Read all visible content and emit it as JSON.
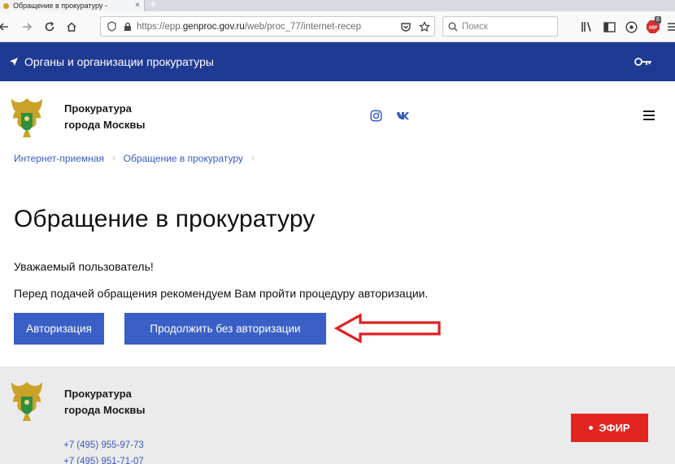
{
  "browser": {
    "tab_title": "Обращение в прокуратуру - ",
    "tab_close": "×",
    "tab_new": "+",
    "url_prefix": "https://epp.",
    "url_domain": "genproc.gov.ru",
    "url_path": "/web/proc_77/internet-recep",
    "search_placeholder": "Поиск",
    "abp_badge": "8"
  },
  "site_strip": {
    "label": "Органы и организации прокуратуры"
  },
  "header": {
    "org_line1": "Прокуратура",
    "org_line2": "города Москвы"
  },
  "breadcrumb": {
    "items": [
      "Интернет-приемная",
      "Обращение в прокуратуру"
    ],
    "separator": "›"
  },
  "main": {
    "title": "Обращение в прокуратуру",
    "greeting": "Уважаемый пользователь!",
    "notice": "Перед подачей обращения рекомендуем Вам пройти процедуру авторизации.",
    "auth_button": "Авторизация",
    "continue_button": "Продолжить без авторизации"
  },
  "footer": {
    "org_line1": "Прокуратура",
    "org_line2": "города Москвы",
    "phones": [
      "+7 (495) 955-97-73",
      "+7 (495) 951-71-07"
    ],
    "live_button": "ЭФИР"
  },
  "colors": {
    "brand_blue": "#1f3a93",
    "button_blue": "#3a5fc6",
    "link_blue": "#3a5bbf",
    "annotation_red": "#e02020",
    "live_red": "#e32521"
  },
  "icons": [
    "back-icon",
    "forward-icon",
    "reload-icon",
    "home-icon",
    "shield-icon",
    "lock-icon",
    "pocket-icon",
    "bookmark-star-icon",
    "search-icon",
    "library-icon",
    "sidebar-icon",
    "adblock-icon",
    "location-arrow-icon",
    "key-icon",
    "emblem-icon",
    "instagram-icon",
    "vk-icon",
    "menu-icon",
    "red-arrow-icon"
  ]
}
